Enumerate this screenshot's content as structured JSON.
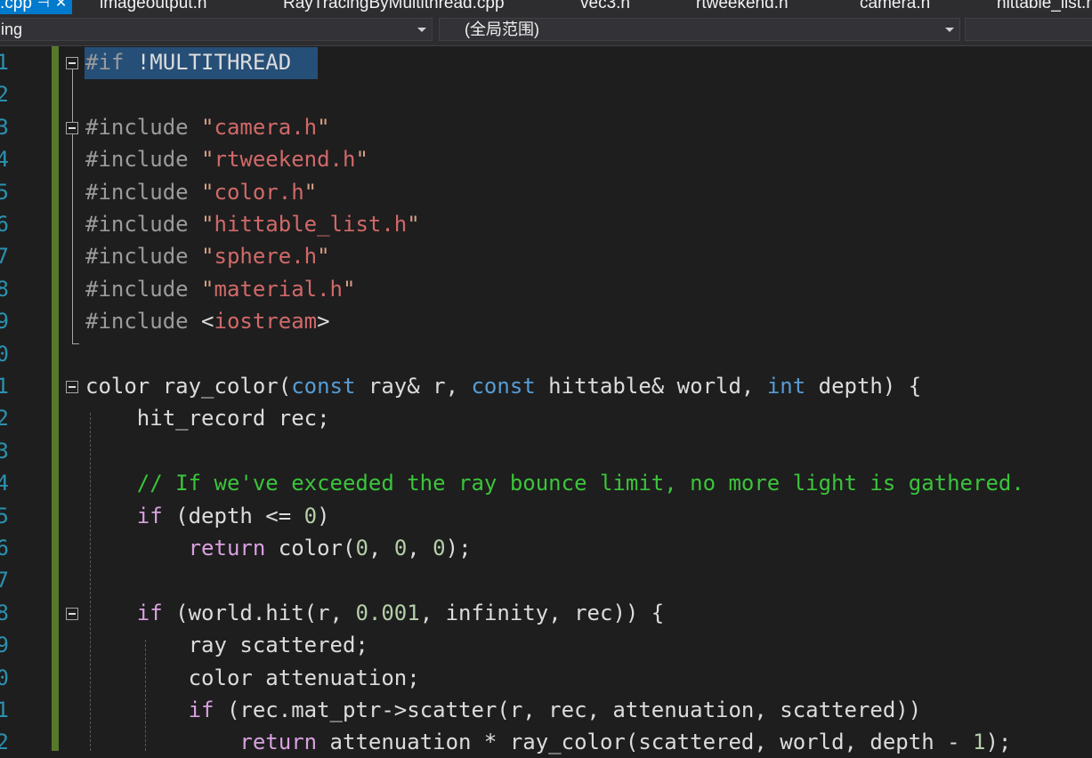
{
  "tabs": [
    {
      "label": ".cpp",
      "active": true
    },
    {
      "label": "imageoutput.h"
    },
    {
      "label": "RayTracingByMultithread.cpp"
    },
    {
      "label": "vec3.h"
    },
    {
      "label": "rtweekend.h"
    },
    {
      "label": "camera.h"
    },
    {
      "label": "hittable_list.h"
    }
  ],
  "navbar": {
    "project_combo": "ing",
    "scope_combo": "(全局范围)"
  },
  "lines": [
    {
      "num": "1",
      "text": "#if !MULTITHREAD"
    },
    {
      "num": "2",
      "text": ""
    },
    {
      "num": "3",
      "text": "#include \"camera.h\""
    },
    {
      "num": "4",
      "text": "#include \"rtweekend.h\""
    },
    {
      "num": "5",
      "text": "#include \"color.h\""
    },
    {
      "num": "6",
      "text": "#include \"hittable_list.h\""
    },
    {
      "num": "7",
      "text": "#include \"sphere.h\""
    },
    {
      "num": "8",
      "text": "#include \"material.h\""
    },
    {
      "num": "9",
      "text": "#include <iostream>"
    },
    {
      "num": "0",
      "text": ""
    },
    {
      "num": "1",
      "text": "color ray_color(const ray& r, const hittable& world, int depth) {"
    },
    {
      "num": "2",
      "text": "    hit_record rec;"
    },
    {
      "num": "3",
      "text": ""
    },
    {
      "num": "4",
      "text": "    // If we've exceeded the ray bounce limit, no more light is gathered."
    },
    {
      "num": "5",
      "text": "    if (depth <= 0)"
    },
    {
      "num": "6",
      "text": "        return color(0, 0, 0);"
    },
    {
      "num": "7",
      "text": ""
    },
    {
      "num": "8",
      "text": "    if (world.hit(r, 0.001, infinity, rec)) {"
    },
    {
      "num": "9",
      "text": "        ray scattered;"
    },
    {
      "num": "0",
      "text": "        color attenuation;"
    },
    {
      "num": "1",
      "text": "        if (rec.mat_ptr->scatter(r, rec, attenuation, scattered))"
    },
    {
      "num": "2",
      "text": "            return attenuation * ray_color(scattered, world, depth - 1);"
    }
  ],
  "colors": {
    "background": "#1e1e1e",
    "line_number": "#2b91af",
    "keyword": "#569cd6",
    "control_keyword": "#d8a0df",
    "string": "#d16969",
    "comment": "#3bc43b",
    "preprocessor": "#9b9b9b",
    "selection": "#264f78",
    "change_bar": "#57782b",
    "tab_active": "#007acc"
  }
}
